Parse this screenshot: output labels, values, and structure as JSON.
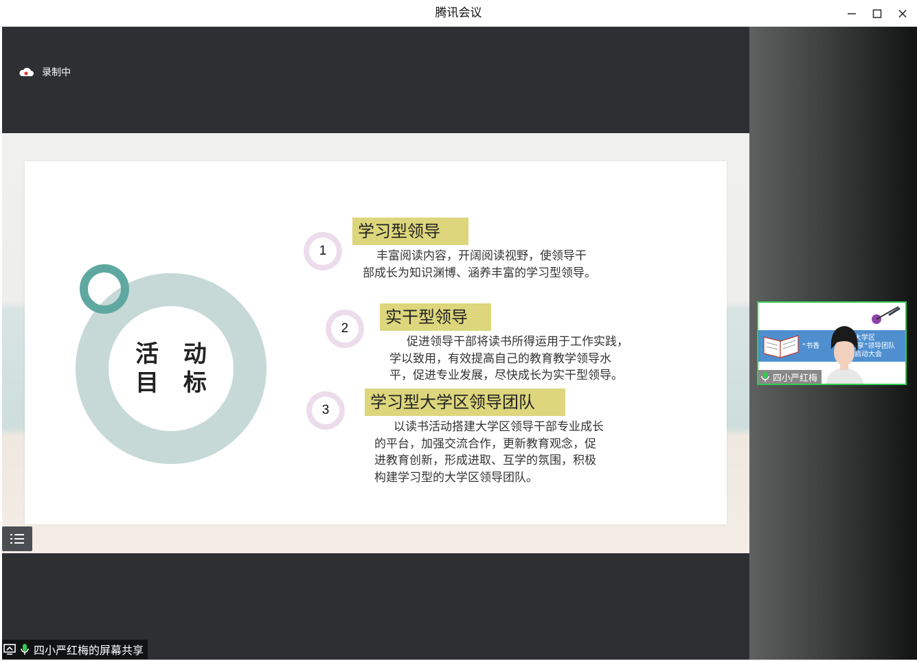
{
  "window": {
    "title": "腾讯会议",
    "minimize_icon": "minimize-icon",
    "maximize_icon": "maximize-icon",
    "close_icon": "close-icon"
  },
  "recording": {
    "label": "录制中",
    "icon": "cloud-icon"
  },
  "slide": {
    "circle_text": "活 动\n目 标",
    "items": [
      {
        "number": "1",
        "heading": "学习型领导",
        "lines": [
          "丰富阅读内容，开阔阅读视野，使领导干",
          "部成长为知识渊博、涵养丰富的学习型领导。"
        ]
      },
      {
        "number": "2",
        "heading": "实干型领导",
        "lines": [
          "促进领导干部将读书所得运用于工作实践，",
          "学以致用，有效提高自己的教育教学领导水",
          "平，促进专业发展，尽快成长为实干型领导。"
        ]
      },
      {
        "number": "3",
        "heading": "学习型大学区领导团队",
        "lines": [
          "以读书活动搭建大学区领导干部专业成长",
          "的平台，加强交流合作，更新教育观念，促",
          "进教育创新，形成进取、互学的氛围，积极",
          "构建学习型的大学区领导团队。"
        ]
      }
    ],
    "colors": {
      "ring": "#c6d9d6",
      "small_ring": "#5fa8a0",
      "tag": "#ddd67c",
      "number_ring": "#ecdcec"
    }
  },
  "toolbar": {
    "list_icon": "list-icon"
  },
  "share_label": {
    "text": "四小严红梅的屏幕共享",
    "share_icon": "screen-share-icon",
    "mic_icon": "microphone-icon"
  },
  "participant": {
    "name": "四小严红梅",
    "mic_icon": "microphone-icon",
    "banner_lines": [
      "大学区",
      "“书香",
      "分享”领导团队",
      "启动大会"
    ],
    "border_color": "#2ecc50"
  }
}
